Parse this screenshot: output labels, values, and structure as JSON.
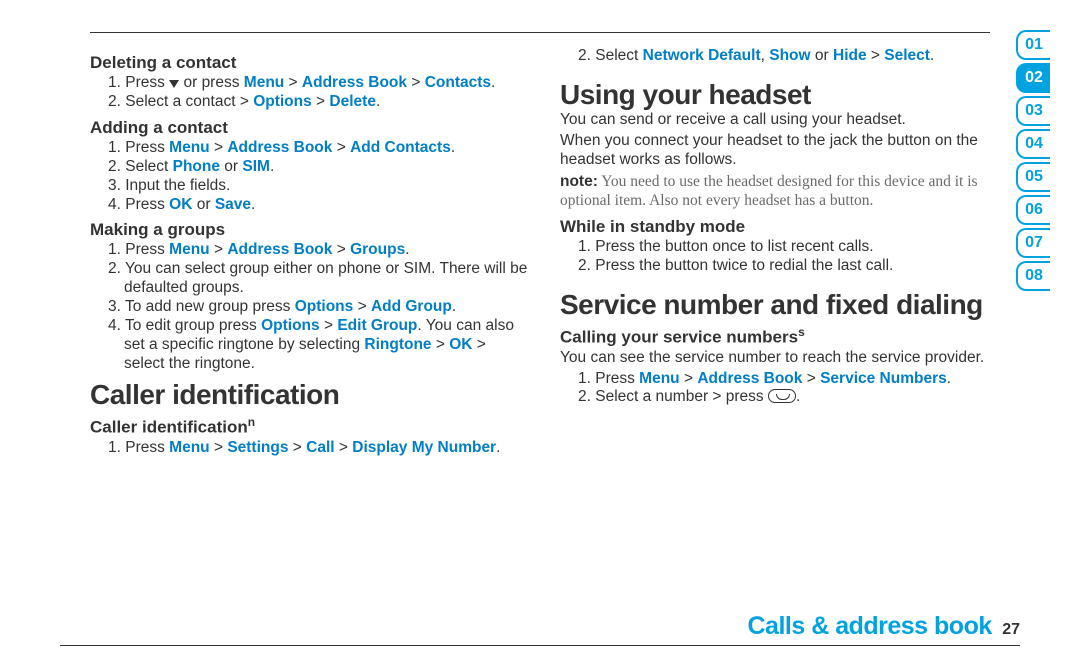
{
  "tabs": [
    "01",
    "02",
    "03",
    "04",
    "05",
    "06",
    "07",
    "08"
  ],
  "active_tab_index": 1,
  "footer": {
    "section": "Calls & address book",
    "page": "27"
  },
  "left": {
    "s1": {
      "title": "Deleting a contact",
      "n1a": "1. Press ",
      "n1b": " or press ",
      "m1": "Menu",
      "gt": " > ",
      "m2": "Address Book",
      "m3": "Contacts",
      "n2a": "2. Select a contact > ",
      "m4": "Options",
      "m5": "Delete",
      "dot": "."
    },
    "s2": {
      "title": "Adding a contact",
      "n1a": "1. Press ",
      "m1": "Menu",
      "m2": "Address Book",
      "m3": "Add Contacts",
      "n2a": "2. Select ",
      "m4": "Phone",
      "or": " or ",
      "m5": "SIM",
      "n3": "3. Input the fields.",
      "n4a": "4. Press ",
      "m6": "OK",
      "m7": "Save"
    },
    "s3": {
      "title": "Making a groups",
      "n1a": "1. Press ",
      "m1": "Menu",
      "m2": "Address Book",
      "m3": "Groups",
      "n2": "2. You can select group either on phone or SIM. There will be defaulted groups.",
      "n3a": "3. To add new group press ",
      "m4": "Options",
      "m5": "Add Group",
      "n4a": "4. To edit group press ",
      "m6": "Options",
      "m7": "Edit Group",
      "n4b": ". You can also set a specific ringtone by selecting ",
      "m8": "Ringtone",
      "m9": "OK",
      "n4c": " > select the ringtone."
    },
    "h1": "Caller identification",
    "s4": {
      "title": "Caller identification",
      "sup": "n",
      "n1a": "1. Press ",
      "m1": "Menu",
      "m2": "Settings",
      "m3": "Call",
      "m4": "Display My Number"
    }
  },
  "right": {
    "s0": {
      "n2a": "2. Select ",
      "m1": "Network Default",
      "c": ", ",
      "m2": "Show",
      "or": " or ",
      "m3": "Hide",
      "gt": " > ",
      "m4": "Select",
      "dot": "."
    },
    "h1": "Using your headset",
    "p1": "You can send or receive a call using your headset.",
    "p2": "When you connect your headset to the jack the button on the headset works as follows.",
    "note_label": "note:",
    "note": " You need to use the headset designed for this device and it is optional item. Also not every headset has a button.",
    "s1": {
      "title": "While in standby mode",
      "n1": "1. Press the button once to list recent calls.",
      "n2": "2. Press the button twice to redial the last call."
    },
    "h2": "Service number and fixed dialing",
    "s2": {
      "title": "Calling your service numbers",
      "sup": "s",
      "p": "You can see the service number to reach the service provider.",
      "n1a": "1. Press ",
      "m1": "Menu",
      "m2": "Address Book",
      "m3": "Service Numbers",
      "n2a": "2. Select a number > press "
    }
  }
}
